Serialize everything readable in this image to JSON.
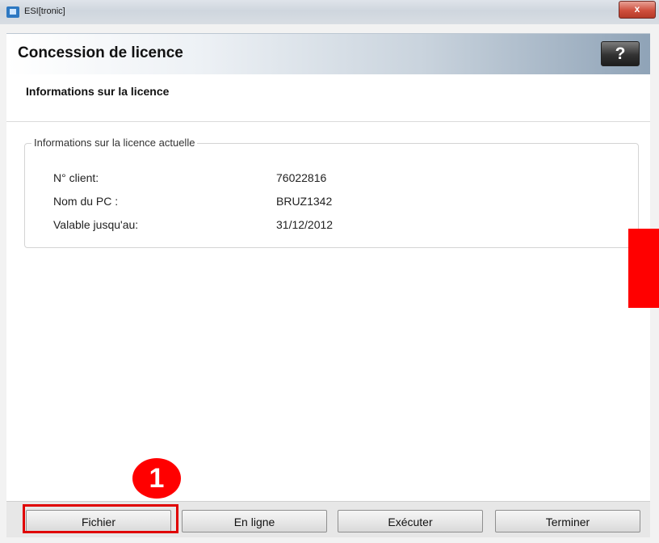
{
  "window": {
    "title": "ESI[tronic]",
    "close_label": "x"
  },
  "header": {
    "title": "Concession de licence",
    "help_label": "?"
  },
  "section": {
    "title": "Informations sur la licence"
  },
  "license_group": {
    "legend": "Informations sur la licence actuelle",
    "rows": [
      {
        "label": "N° client:",
        "value": "76022816"
      },
      {
        "label": "Nom du PC :",
        "value": "BRUZ1342"
      },
      {
        "label": "Valable jusqu'au:",
        "value": "31/12/2012"
      }
    ]
  },
  "annotation": {
    "step_number": "1",
    "step_color": "#ff0000"
  },
  "buttons": {
    "fichier": "Fichier",
    "en_ligne": "En ligne",
    "executer": "Exécuter",
    "terminer": "Terminer"
  }
}
